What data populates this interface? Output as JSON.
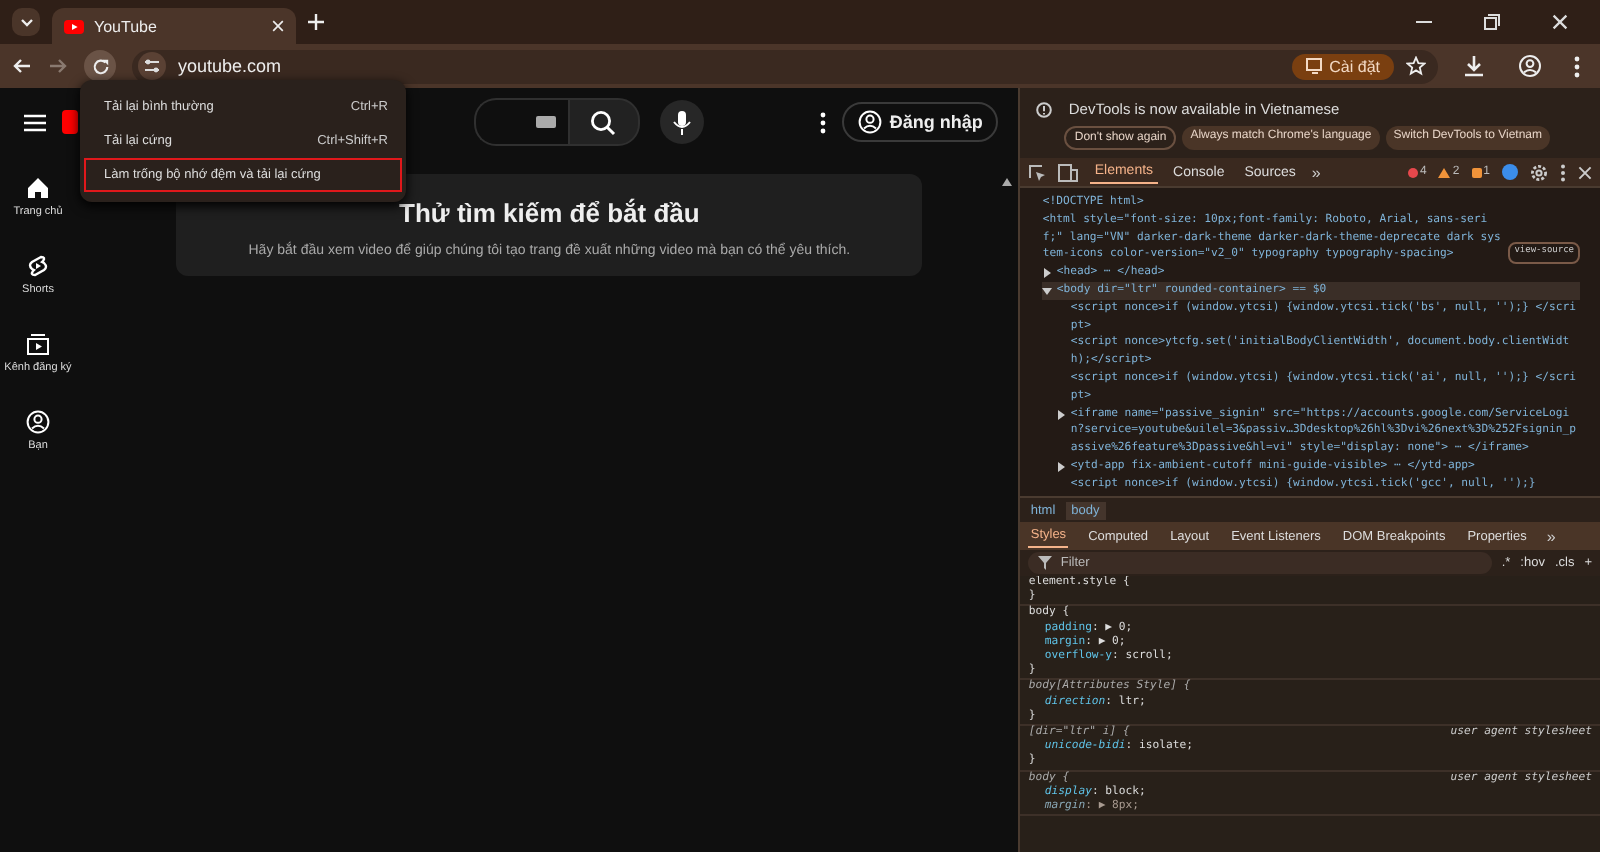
{
  "browser": {
    "tabs": [
      {
        "title": "YouTube",
        "selected": true
      }
    ],
    "address": "youtube.com",
    "install_chip": "Cài đặt"
  },
  "reload_menu": {
    "items": [
      {
        "label": "Tải lại bình thường",
        "shortcut": "Ctrl+R",
        "highlighted": false
      },
      {
        "label": "Tải lại cứng",
        "shortcut": "Ctrl+Shift+R",
        "highlighted": false
      },
      {
        "label": "Làm trống bộ nhớ đệm và tải lại cứng",
        "highlighted": true
      }
    ]
  },
  "youtube": {
    "sign_in": "Đăng nhập",
    "sidebar": [
      {
        "label": "Trang chủ",
        "kind": "home"
      },
      {
        "label": "Shorts",
        "kind": "shorts"
      },
      {
        "label": "Kênh đăng ký",
        "kind": "subscriptions"
      },
      {
        "label": "Bạn",
        "kind": "you"
      }
    ],
    "card": {
      "title": "Thử tìm kiếm để bắt đầu",
      "text": "Hãy bắt đầu xem video để giúp chúng tôi tạo trang đề xuất những video mà bạn có thể yêu thích."
    }
  },
  "devtools": {
    "notice": {
      "text": "DevTools is now available in Vietnamese",
      "buttons": [
        "Don't show again",
        "Always match Chrome's language",
        "Switch DevTools to Vietnam"
      ]
    },
    "tabs": [
      {
        "label": "Elements",
        "selected": true
      },
      {
        "label": "Console",
        "selected": false
      },
      {
        "label": "Sources",
        "selected": false
      }
    ],
    "more": "»",
    "counts": [
      {
        "kind": "error",
        "value": "4"
      },
      {
        "kind": "warning",
        "value": "2"
      },
      {
        "kind": "info",
        "value": "1"
      }
    ],
    "dom_tree": [
      {
        "text": "<!DOCTYPE html>"
      },
      {
        "text": "<html style=\"font-size: 10px;font-family: Roboto, Arial, sans-serif;\" lang=\"VN\" darker-dark-theme darker-dark-theme-deprecate dark system-icons color-version=\"v2_0\" typography typography-spacing>",
        "badge": "view-source",
        "children": [
          {
            "text": "<head> ⋯ </head>",
            "expanded": false
          },
          {
            "text": "<body dir=\"ltr\" rounded-container> == $0",
            "expanded": true,
            "selected": true,
            "children": [
              {
                "text": "<script nonce>if (window.ytcsi) {window.ytcsi.tick('bs', null, '');} </script>"
              },
              {
                "text": "<script nonce>ytcfg.set('initialBodyClientWidth', document.body.clientWidth);</script>"
              },
              {
                "text": "<script nonce>if (window.ytcsi) {window.ytcsi.tick('ai', null, '');} </script>"
              },
              {
                "text": "<iframe name=\"passive_signin\" src=\"https://accounts.google.com/ServiceLogin?service=youtube&uilel=3&passiv…3Ddesktop%26hl%3Dvi%26next%3D%252Fsignin_passive%26feature%3Dpassive&hl=vi\" style=\"display: none\"> ⋯ </iframe>",
                "expanded": false
              },
              {
                "text": "<ytd-app fix-ambient-cutoff mini-guide-visible> ⋯ </ytd-app>",
                "expanded": false
              },
              {
                "text": "<script nonce>if (window.ytcsi) {window.ytcsi.tick('gcc', null, '');}"
              }
            ]
          }
        ]
      }
    ],
    "breadcrumb": [
      {
        "label": "html",
        "selected": false
      },
      {
        "label": "body",
        "selected": true
      }
    ],
    "style_tabs": [
      {
        "label": "Styles",
        "selected": true
      },
      {
        "label": "Computed",
        "selected": false
      },
      {
        "label": "Layout",
        "selected": false
      },
      {
        "label": "Event Listeners",
        "selected": false
      },
      {
        "label": "DOM Breakpoints",
        "selected": false
      },
      {
        "label": "Properties",
        "selected": false
      }
    ],
    "style_more": "»",
    "filter": {
      "placeholder": "Filter",
      "tools": [
        ".*",
        ":hov",
        ".cls",
        "+"
      ]
    },
    "rules": [
      {
        "selector": "element.style {",
        "italic": false,
        "end": "}"
      },
      {
        "selector": "body {",
        "italic": false,
        "declarations": [
          {
            "prop": "padding",
            "value": ": ▶ 0;",
            "struck": false
          },
          {
            "prop": "margin",
            "value": ": ▶ 0;",
            "struck": false
          },
          {
            "prop": "overflow-y",
            "value": ": scroll;",
            "struck": false
          }
        ],
        "end": "}"
      },
      {
        "selector": "body[Attributes Style] {",
        "italic": true,
        "declarations": [
          {
            "prop": "direction",
            "value": ": ltr;",
            "struck": false
          }
        ],
        "end": "}"
      },
      {
        "selector": "[dir=\"ltr\" i] {",
        "italic": true,
        "source": "user agent stylesheet",
        "declarations": [
          {
            "prop": "unicode-bidi",
            "value": ": isolate;",
            "struck": false
          }
        ],
        "end": "}"
      },
      {
        "selector": "body {",
        "italic": true,
        "source": "user agent stylesheet",
        "declarations": [
          {
            "prop": "display",
            "value": ": block;",
            "struck": false
          },
          {
            "prop": "margin",
            "value": ": ▶ 8px;",
            "struck": true
          }
        ]
      }
    ]
  }
}
